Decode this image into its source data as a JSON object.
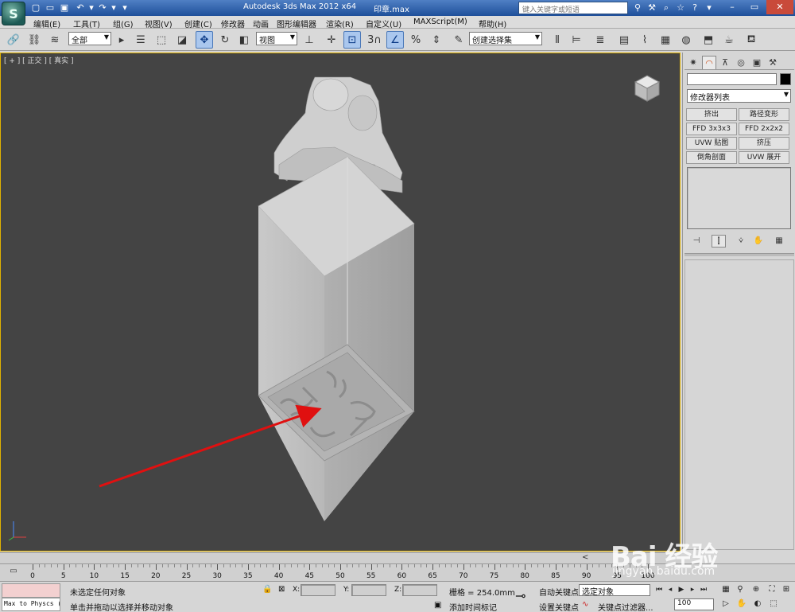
{
  "titlebar": {
    "app_title": "Autodesk 3ds Max  2012 x64",
    "file_name": "印章.max",
    "search_placeholder": "键入关键字或短语",
    "logo_letter": "S"
  },
  "menu": [
    "编辑(E)",
    "工具(T)",
    "组(G)",
    "视图(V)",
    "创建(C)",
    "修改器",
    "动画",
    "图形编辑器",
    "渲染(R)",
    "自定义(U)",
    "MAXScript(M)",
    "帮助(H)"
  ],
  "toolbar": {
    "selection_filter": "全部",
    "ref_coord": "视图",
    "named_selection": "创建选择集",
    "snap_label": "3"
  },
  "viewport": {
    "label": "[ + ] [ 正交 ] [ 真实 ]"
  },
  "command_panel": {
    "modifier_list": "修改器列表",
    "modifier_buttons": [
      "挤出",
      "路径变形",
      "FFD 3x3x3",
      "FFD 2x2x2",
      "UVW 贴图",
      "挤压",
      "倒角剖面",
      "UVW 展开"
    ]
  },
  "trackbar": {
    "ticks": [
      "0",
      "5",
      "10",
      "15",
      "20",
      "25",
      "30",
      "35",
      "40",
      "45",
      "50",
      "55",
      "60",
      "65",
      "70",
      "75",
      "80",
      "85",
      "90",
      "95",
      "100"
    ]
  },
  "statusbar": {
    "listener_text": "Max to Physcs (",
    "selection_status": "未选定任何对象",
    "prompt": "单击并拖动以选择并移动对象",
    "x_label": "X:",
    "y_label": "Y:",
    "z_label": "Z:",
    "grid": "栅格 = 254.0mm",
    "add_time_tag": "添加时间标记",
    "auto_key": "自动关键点",
    "set_key": "设置关键点",
    "key_filter_dd": "选定对象",
    "key_filters": "关键点过滤器...",
    "frame_value": "100"
  },
  "watermark": {
    "brand": "Bai 经验",
    "url": "jingyan.baidu.com"
  }
}
